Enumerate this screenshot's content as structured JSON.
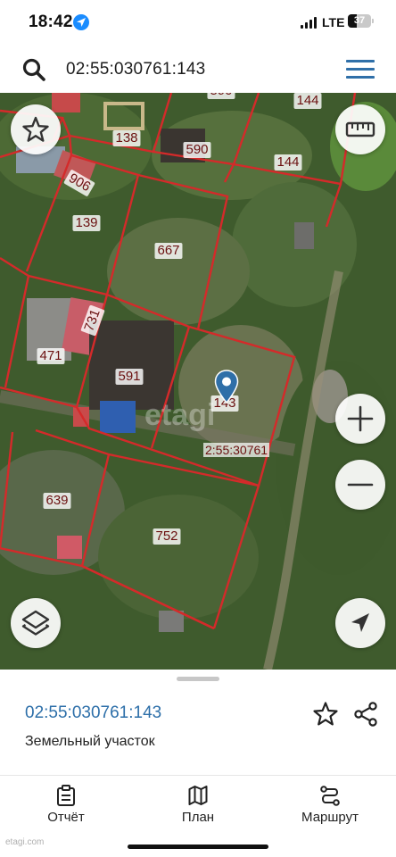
{
  "status_bar": {
    "time": "18:42",
    "network": "LTE",
    "battery": "37",
    "battery_level": 0.37
  },
  "search": {
    "value": "02:55:030761:143",
    "icon": "search-icon",
    "menu_icon": "hamburger-menu-icon"
  },
  "map": {
    "parcels": [
      "138",
      "590",
      "144",
      "144",
      "906",
      "139",
      "667",
      "731",
      "471",
      "591",
      "143",
      "639",
      "752"
    ],
    "cadastral_quarter": "2:55:30761",
    "watermark": "etagi",
    "colors": {
      "boundary": "#d42a2a",
      "label_text": "#6b1010",
      "pin": "#2f6fa8"
    },
    "buttons": {
      "favorites": "star-icon",
      "ruler": "ruler-icon",
      "zoom_in": "plus-icon",
      "zoom_out": "minus-icon",
      "layers": "layers-icon",
      "locate": "navigation-arrow-icon"
    }
  },
  "sheet": {
    "title": "02:55:030761:143",
    "subtitle": "Земельный участок",
    "actions": [
      "star-icon",
      "share-icon"
    ]
  },
  "tabbar": {
    "tabs": [
      {
        "label": "Отчёт",
        "icon": "clipboard-icon"
      },
      {
        "label": "План",
        "icon": "map-icon"
      },
      {
        "label": "Маршрут",
        "icon": "route-icon"
      }
    ]
  },
  "corner_mark": "etagi.com"
}
